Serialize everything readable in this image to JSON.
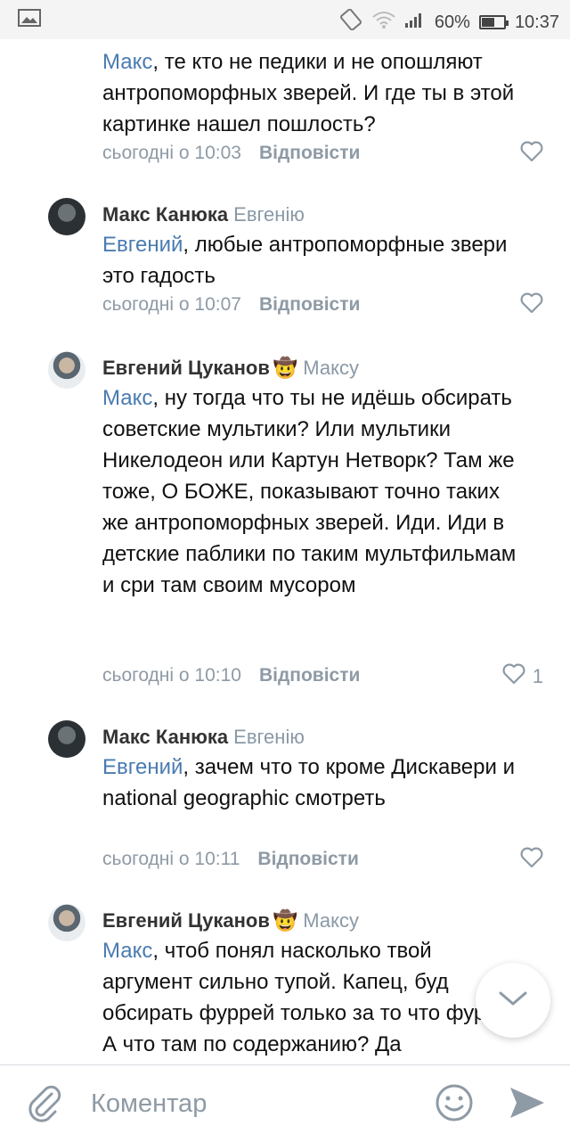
{
  "status_bar": {
    "left_icon": "image-icon",
    "battery_percent": "60%",
    "battery_level": 0.6,
    "time": "10:37"
  },
  "comments": [
    {
      "author": "",
      "reply_to": "",
      "mention": "Макс",
      "text": ", те кто не педики и не опошляют антропоморфных зверей. И где ты в этой картинке нашел пошлость?",
      "date": "сьогодні о 10:03",
      "reply_label": "Відповісти",
      "likes": ""
    },
    {
      "author": "Макс Канюка",
      "reply_to": "Евгенію",
      "mention": "Евгений",
      "text": ", любые антропоморфные звери это гадость",
      "date": "сьогодні о 10:07",
      "reply_label": "Відповісти",
      "likes": ""
    },
    {
      "author": "Евгений Цуканов",
      "emoji": "🤠",
      "reply_to": "Максу",
      "mention": "Макс",
      "text": ", ну тогда что ты не идёшь обсирать советские мультики? Или мультики Никелодеон или Картун Нетворк? Там же тоже, О БОЖЕ, показывают точно таких же антропоморфных зверей. Иди. Иди в детские паблики по таким мультфильмам и сри там своим мусором",
      "date": "сьогодні о 10:10",
      "reply_label": "Відповісти",
      "likes": "1"
    },
    {
      "author": "Макс Канюка",
      "reply_to": "Евгенію",
      "mention": "Евгений",
      "text": ", зачем что то кроме Дискавери и national geographic смотреть",
      "date": "сьогодні о 10:11",
      "reply_label": "Відповісти",
      "likes": ""
    },
    {
      "author": "Евгений Цуканов",
      "emoji": "🤠",
      "reply_to": "Максу",
      "mention": "Макс",
      "text": ", чтоб понял насколько твой аргумент сильно тупой. Капец, буд обсирать фуррей только за то что фурри. А что там по содержанию? Да",
      "date": "",
      "reply_label": "",
      "likes": ""
    }
  ],
  "composer": {
    "placeholder": "Коментар"
  },
  "colors": {
    "mention": "#4a7bb0",
    "meta": "#8e9aa5",
    "author": "#333333"
  }
}
